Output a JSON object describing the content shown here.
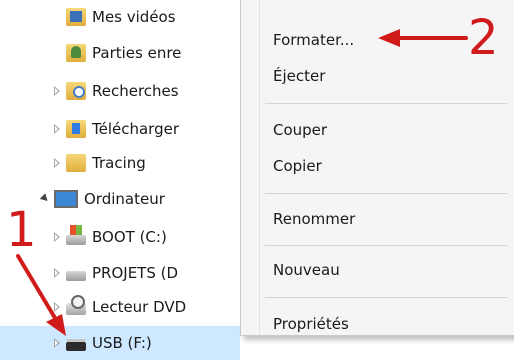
{
  "tree": {
    "items": [
      {
        "label": "Mes vidéos",
        "icon": "video-folder-icon",
        "expand": ""
      },
      {
        "label": "Parties enre",
        "icon": "shared-folder-icon",
        "expand": ""
      },
      {
        "label": "Recherches",
        "icon": "search-folder-icon",
        "expand": "right"
      },
      {
        "label": "Télécharger",
        "icon": "downloads-folder-icon",
        "expand": "right"
      },
      {
        "label": "Tracing",
        "icon": "folder-icon",
        "expand": "right"
      },
      {
        "label": "Ordinateur",
        "icon": "computer-icon",
        "expand": "down"
      },
      {
        "label": "BOOT (C:)",
        "icon": "windows-drive-icon",
        "expand": "right"
      },
      {
        "label": "PROJETS (D",
        "icon": "hard-drive-icon",
        "expand": "right"
      },
      {
        "label": "Lecteur DVD",
        "icon": "dvd-drive-icon",
        "expand": "right"
      },
      {
        "label": "USB (F:)",
        "icon": "usb-drive-icon",
        "expand": "right",
        "selected": true
      }
    ]
  },
  "context_menu": {
    "format": "Formater...",
    "eject": "Éjecter",
    "cut": "Couper",
    "copy": "Copier",
    "rename": "Renommer",
    "new": "Nouveau",
    "properties": "Propriétés"
  },
  "annotations": {
    "marker_1": "1",
    "marker_2": "2",
    "color": "#d01b1b"
  },
  "colors": {
    "selection": "#cde8ff",
    "menu_background": "#f5f5f5"
  }
}
